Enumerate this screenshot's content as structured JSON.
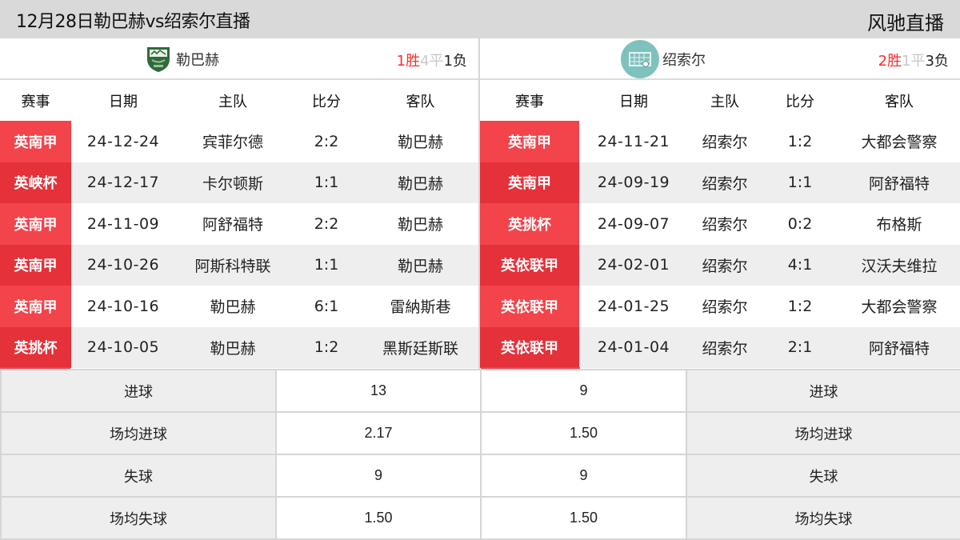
{
  "header": {
    "title": "12月28日勒巴赫vs绍索尔直播",
    "brand": "风驰直播"
  },
  "colors": {
    "accent_red": "#f3434b",
    "accent_red_dark": "#e5313a",
    "win": "#ff2a2a",
    "draw": "#c8c8c8",
    "loss": "#222222",
    "header_bg": "#d9d9d9"
  },
  "left": {
    "team_name": "勒巴赫",
    "crest_icon": "shield-crest-icon",
    "record": {
      "wins": "1胜",
      "draws": "4平",
      "losses": "1负"
    },
    "columns": [
      "赛事",
      "日期",
      "主队",
      "比分",
      "客队"
    ],
    "matches": [
      {
        "competition": "英南甲",
        "date": "24-12-24",
        "home": "宾菲尔德",
        "score": "2:2",
        "away": "勒巴赫"
      },
      {
        "competition": "英峡杯",
        "date": "24-12-17",
        "home": "卡尔顿斯",
        "score": "1:1",
        "away": "勒巴赫"
      },
      {
        "competition": "英南甲",
        "date": "24-11-09",
        "home": "阿舒福特",
        "score": "2:2",
        "away": "勒巴赫"
      },
      {
        "competition": "英南甲",
        "date": "24-10-26",
        "home": "阿斯科特联",
        "score": "1:1",
        "away": "勒巴赫"
      },
      {
        "competition": "英南甲",
        "date": "24-10-16",
        "home": "勒巴赫",
        "score": "6:1",
        "away": "雷納斯巷"
      },
      {
        "competition": "英挑杯",
        "date": "24-10-05",
        "home": "勒巴赫",
        "score": "1:2",
        "away": "黑斯廷斯联"
      }
    ]
  },
  "right": {
    "team_name": "绍索尔",
    "crest_icon": "goal-net-crest-icon",
    "record": {
      "wins": "2胜",
      "draws": "1平",
      "losses": "3负"
    },
    "columns": [
      "赛事",
      "日期",
      "主队",
      "比分",
      "客队"
    ],
    "matches": [
      {
        "competition": "英南甲",
        "date": "24-11-21",
        "home": "绍索尔",
        "score": "1:2",
        "away": "大都会警察"
      },
      {
        "competition": "英南甲",
        "date": "24-09-19",
        "home": "绍索尔",
        "score": "1:1",
        "away": "阿舒福特"
      },
      {
        "competition": "英挑杯",
        "date": "24-09-07",
        "home": "绍索尔",
        "score": "0:2",
        "away": "布格斯"
      },
      {
        "competition": "英依联甲",
        "date": "24-02-01",
        "home": "绍索尔",
        "score": "4:1",
        "away": "汉沃夫维拉"
      },
      {
        "competition": "英依联甲",
        "date": "24-01-25",
        "home": "绍索尔",
        "score": "1:2",
        "away": "大都会警察"
      },
      {
        "competition": "英依联甲",
        "date": "24-01-04",
        "home": "绍索尔",
        "score": "2:1",
        "away": "阿舒福特"
      }
    ]
  },
  "stats": [
    {
      "label": "进球",
      "left": "13",
      "right": "9"
    },
    {
      "label": "场均进球",
      "left": "2.17",
      "right": "1.50"
    },
    {
      "label": "失球",
      "left": "9",
      "right": "9"
    },
    {
      "label": "场均失球",
      "left": "1.50",
      "right": "1.50"
    }
  ]
}
